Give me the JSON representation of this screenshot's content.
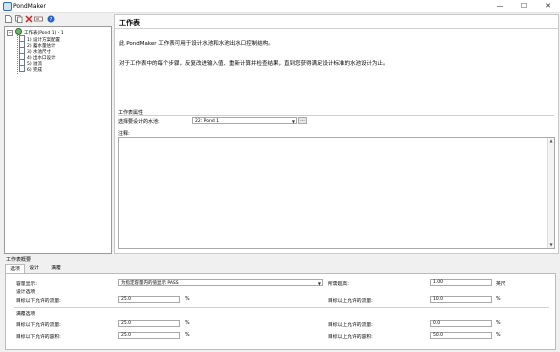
{
  "window": {
    "title": "PondMaker",
    "minimize": "—",
    "maximize": "☐",
    "close": "✕"
  },
  "toolbar": {
    "new_icon": "new-file-icon",
    "copy_icon": "copy-icon",
    "delete_icon": "delete-icon",
    "rename_icon": "rename-icon",
    "help_icon": "help-icon",
    "help_glyph": "?"
  },
  "tree": {
    "root": "工作表(Pond 1) - 1",
    "items": [
      {
        "label": "1) 设计方案配置"
      },
      {
        "label": "2) 蓄水量估计"
      },
      {
        "label": "3) 水池尺寸"
      },
      {
        "label": "4) 出水口设计"
      },
      {
        "label": "5) 溢流"
      },
      {
        "label": "6) 完成"
      }
    ]
  },
  "main": {
    "heading": "工作表",
    "para1": "此 PondMaker 工作表可用于设计水池和水池出水口控制结构。",
    "para2": "对于工作表中的每个步骤，反复改进输入值、重新计算并检查结果，直到您获得满足设计标准的水池设计为止。",
    "props_label": "工作表属性",
    "pond_select_label": "选择要设计的水池:",
    "pond_select_value": "22: Pond 1",
    "pond_button": "...",
    "notes_label": "注释:"
  },
  "bottom": {
    "title": "工作表概要",
    "tabs": [
      "选项",
      "设计",
      "满覆"
    ],
    "capacity_label": "容量显示:",
    "capacity_value": "为指定容量内的值显示 PASS",
    "required_freeboard_label": "所需超高:",
    "required_freeboard_value": "1.00",
    "required_freeboard_unit": "英尺",
    "design_options_label": "设计选项",
    "below_target_label": "目标以下允许的流量:",
    "below_target_value": "25.0",
    "below_target_unit": "%",
    "above_target_label": "目标以上允许的流量:",
    "above_target_value": "10.0",
    "above_target_unit": "%",
    "full_options_label": "满覆选项",
    "full_below_flow_label": "目标以下允许的流量:",
    "full_below_flow_value": "25.0",
    "full_below_flow_unit": "%",
    "full_above_flow_label": "目标以上允许的流量:",
    "full_above_flow_value": "0.0",
    "full_above_flow_unit": "%",
    "full_below_vol_label": "目标以下允许的容积:",
    "full_below_vol_value": "25.0",
    "full_below_vol_unit": "%",
    "full_above_vol_label": "目标以上允许的容积:",
    "full_above_vol_value": "50.0",
    "full_above_vol_unit": "%"
  },
  "colors": {
    "accent": "#3a6ea5",
    "panel_bg": "#f0f0f0",
    "white": "#ffffff"
  }
}
